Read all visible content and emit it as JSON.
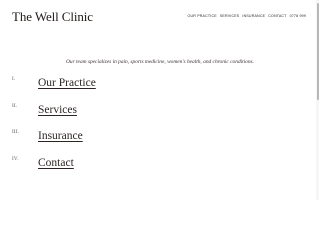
{
  "header": {
    "logo": "The Well Clinic",
    "nav": [
      "Our Practice",
      "Services",
      "Insurance",
      "Contact",
      "0778 999"
    ]
  },
  "intro": "Our team specializes in pain, sports medicine, women's health, and chronic conditions.",
  "menu": [
    {
      "numeral": "I.",
      "label": "Our Practice"
    },
    {
      "numeral": "II.",
      "label": "Services"
    },
    {
      "numeral": "III.",
      "label": "Insurance"
    },
    {
      "numeral": "IV.",
      "label": "Contact"
    }
  ]
}
